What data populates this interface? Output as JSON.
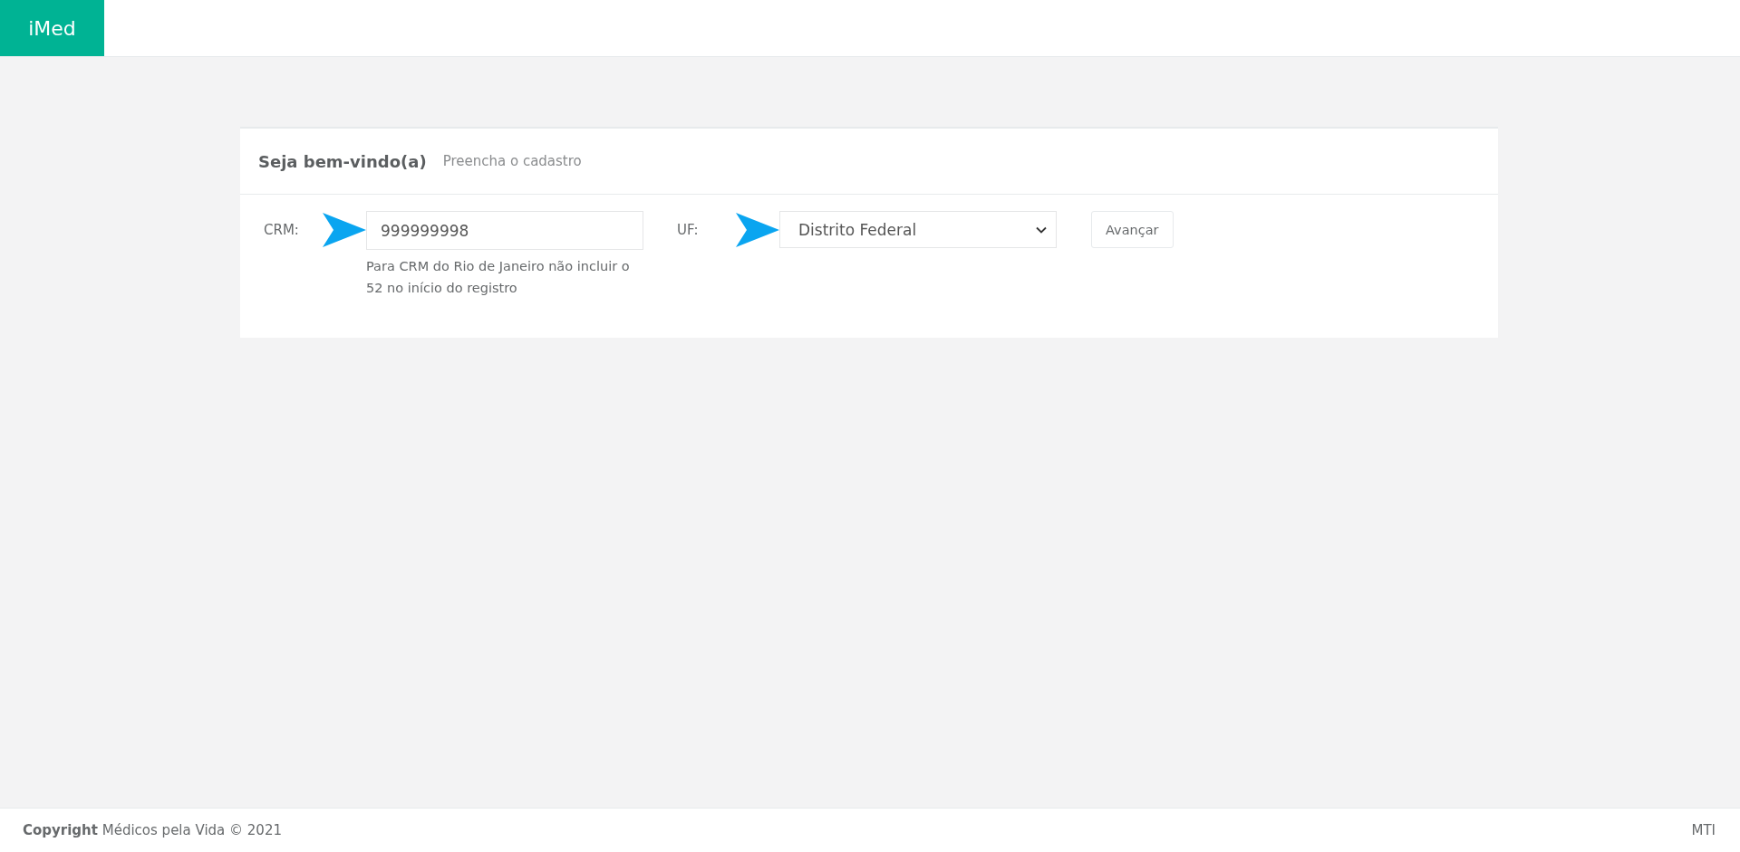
{
  "brand": "iMed",
  "card": {
    "title": "Seja bem-vindo(a)",
    "subtitle": "Preencha o cadastro",
    "crm": {
      "label": "CRM:",
      "value": "999999998",
      "help": "Para CRM do Rio de Janeiro não incluir o 52 no início do registro"
    },
    "uf": {
      "label": "UF:",
      "value": "Distrito Federal"
    },
    "button": "Avançar"
  },
  "footer": {
    "copyright": "**Copyright** Médicos pela Vida © 2021",
    "right": "MTI"
  }
}
